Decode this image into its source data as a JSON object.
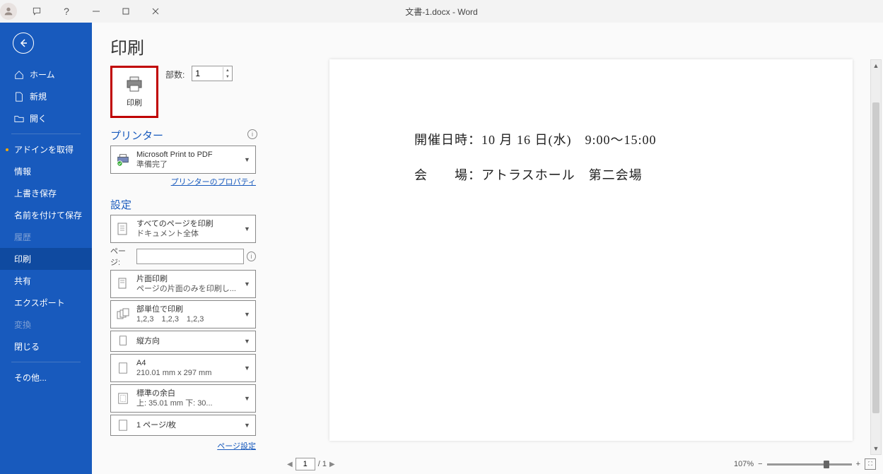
{
  "titlebar": {
    "title": "文書-1.docx - Word"
  },
  "sidebar": {
    "home": "ホーム",
    "new": "新規",
    "open": "開く",
    "addins": "アドインを取得",
    "info": "情報",
    "save": "上書き保存",
    "saveas": "名前を付けて保存",
    "history": "履歴",
    "print": "印刷",
    "share": "共有",
    "export": "エクスポート",
    "transform": "変換",
    "close": "閉じる",
    "more": "その他..."
  },
  "print_page": {
    "title": "印刷",
    "print_button": "印刷",
    "copies_label": "部数:",
    "copies_value": "1",
    "printer_section": "プリンター",
    "printer_name": "Microsoft Print to PDF",
    "printer_status": "準備完了",
    "printer_props": "プリンターのプロパティ",
    "settings_section": "設定",
    "print_all_title": "すべてのページを印刷",
    "print_all_sub": "ドキュメント全体",
    "pages_label": "ページ:",
    "sides_title": "片面印刷",
    "sides_sub": "ページの片面のみを印刷し...",
    "collate_title": "部単位で印刷",
    "collate_sub": "1,2,3　1,2,3　1,2,3",
    "orientation": "縦方向",
    "paper_title": "A4",
    "paper_sub": "210.01 mm x 297 mm",
    "margins_title": "標準の余白",
    "margins_sub": "上: 35.01 mm 下: 30...",
    "pages_per_sheet": "1 ページ/枚",
    "page_setup": "ページ設定"
  },
  "preview": {
    "line1": "開催日時：10 月 16 日(水)　9:00～15:00",
    "line2": "会　　場：アトラスホール　第二会場",
    "current_page": "1",
    "total_pages": "/ 1",
    "zoom": "107%"
  }
}
